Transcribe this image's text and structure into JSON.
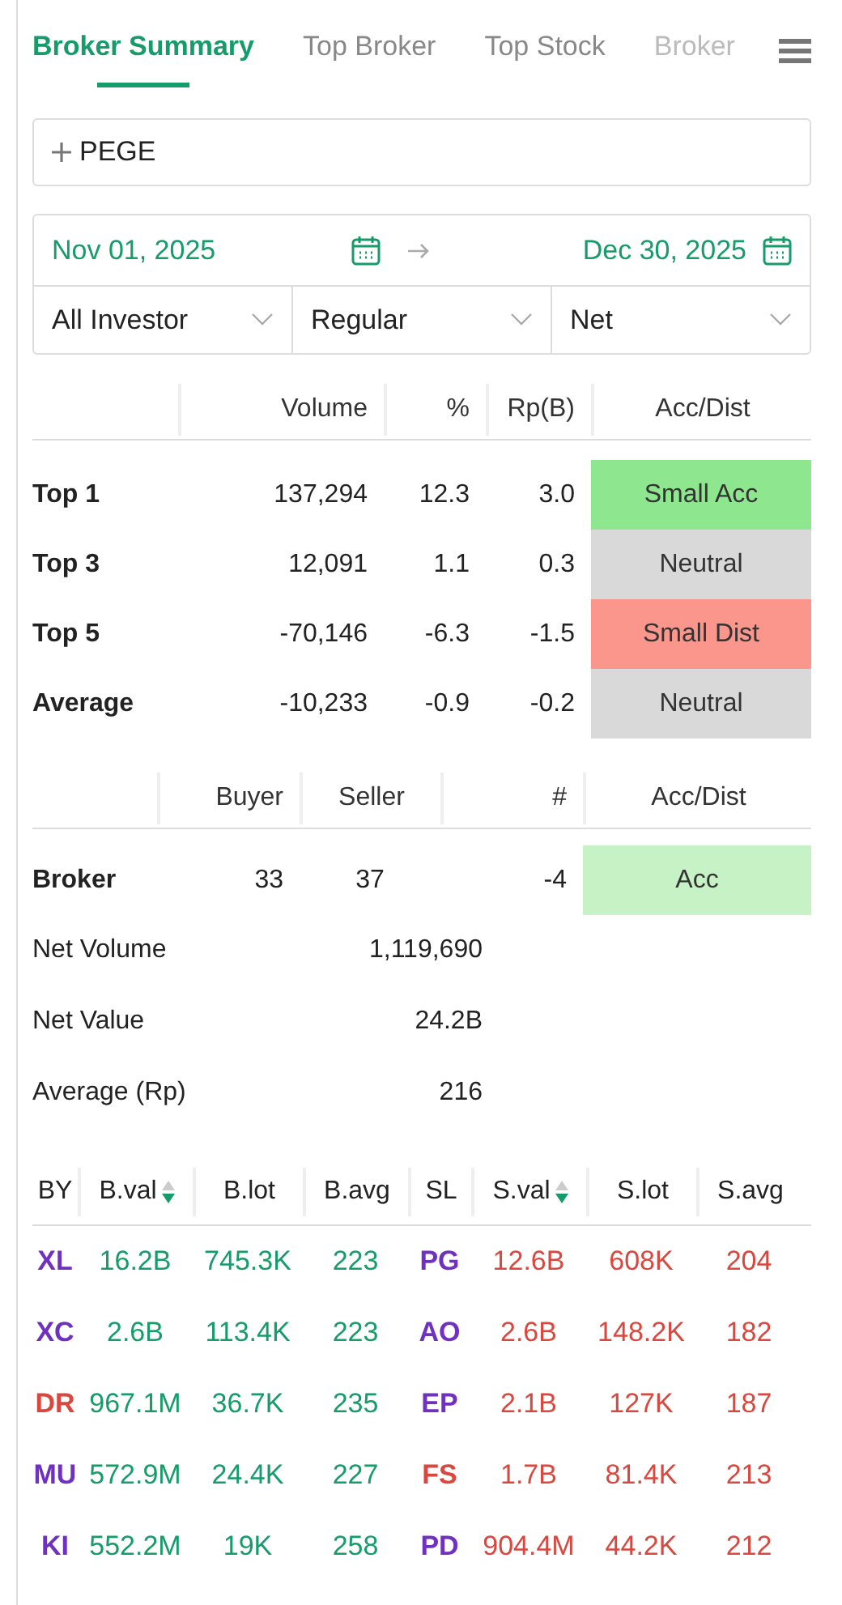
{
  "tabs": [
    {
      "label": "Broker Summary",
      "selected": true
    },
    {
      "label": "Top Broker",
      "selected": false
    },
    {
      "label": "Top Stock",
      "selected": false
    },
    {
      "label": "Broker",
      "selected": false
    }
  ],
  "stock": {
    "value": "PEGE"
  },
  "date_range": {
    "start": "Nov 01, 2025",
    "end": "Dec 30, 2025"
  },
  "filters": [
    "All Investor",
    "Regular",
    "Net"
  ],
  "summary": {
    "columns": [
      "Volume",
      "%",
      "Rp(B)",
      "Acc/Dist"
    ],
    "rows": [
      {
        "label": "Top 1",
        "volume": "137,294",
        "percent": "12.3",
        "rp": "3.0",
        "status": "Small Acc",
        "color": "#8ee68e"
      },
      {
        "label": "Top 3",
        "volume": "12,091",
        "percent": "1.1",
        "rp": "0.3",
        "status": "Neutral",
        "color": "#d9d9d9"
      },
      {
        "label": "Top 5",
        "volume": "-70,146",
        "percent": "-6.3",
        "rp": "-1.5",
        "status": "Small Dist",
        "color": "#fa968c"
      },
      {
        "label": "Average",
        "volume": "-10,233",
        "percent": "-0.9",
        "rp": "-0.2",
        "status": "Neutral",
        "color": "#d9d9d9"
      }
    ]
  },
  "broker_stats": {
    "columns": [
      "Buyer",
      "Seller",
      "#",
      "Acc/Dist"
    ],
    "broker": {
      "label": "Broker",
      "buyer": "33",
      "seller": "37",
      "net": "-4",
      "status": "Acc",
      "color": "#c6f2c6"
    },
    "totals": [
      {
        "label": "Net Volume",
        "value": "1,119,690"
      },
      {
        "label": "Net Value",
        "value": "24.2B"
      },
      {
        "label": "Average (Rp)",
        "value": "216"
      }
    ]
  },
  "trades": {
    "columns": [
      {
        "label": "BY",
        "sorted": false
      },
      {
        "label": "B.val",
        "sorted": true
      },
      {
        "label": "B.lot",
        "sorted": false
      },
      {
        "label": "B.avg",
        "sorted": false
      },
      {
        "label": "SL",
        "sorted": false
      },
      {
        "label": "S.val",
        "sorted": true
      },
      {
        "label": "S.lot",
        "sorted": false
      },
      {
        "label": "S.avg",
        "sorted": false
      }
    ],
    "rows": [
      {
        "buyer": {
          "code": "XL",
          "color": "#7030c0"
        },
        "bval": "16.2B",
        "blot": "745.3K",
        "bavg": "223",
        "seller": {
          "code": "PG",
          "color": "#7030c0"
        },
        "sval": "12.6B",
        "slot": "608K",
        "savg": "204"
      },
      {
        "buyer": {
          "code": "XC",
          "color": "#7030c0"
        },
        "bval": "2.6B",
        "blot": "113.4K",
        "bavg": "223",
        "seller": {
          "code": "AO",
          "color": "#7030c0"
        },
        "sval": "2.6B",
        "slot": "148.2K",
        "savg": "182"
      },
      {
        "buyer": {
          "code": "DR",
          "color": "#d9473f"
        },
        "bval": "967.1M",
        "blot": "36.7K",
        "bavg": "235",
        "seller": {
          "code": "EP",
          "color": "#7030c0"
        },
        "sval": "2.1B",
        "slot": "127K",
        "savg": "187"
      },
      {
        "buyer": {
          "code": "MU",
          "color": "#7030c0"
        },
        "bval": "572.9M",
        "blot": "24.4K",
        "bavg": "227",
        "seller": {
          "code": "FS",
          "color": "#d9473f"
        },
        "sval": "1.7B",
        "slot": "81.4K",
        "savg": "213"
      },
      {
        "buyer": {
          "code": "KI",
          "color": "#7030c0"
        },
        "bval": "552.2M",
        "blot": "19K",
        "bavg": "258",
        "seller": {
          "code": "PD",
          "color": "#7030c0"
        },
        "sval": "904.4M",
        "slot": "44.2K",
        "savg": "212"
      }
    ]
  }
}
